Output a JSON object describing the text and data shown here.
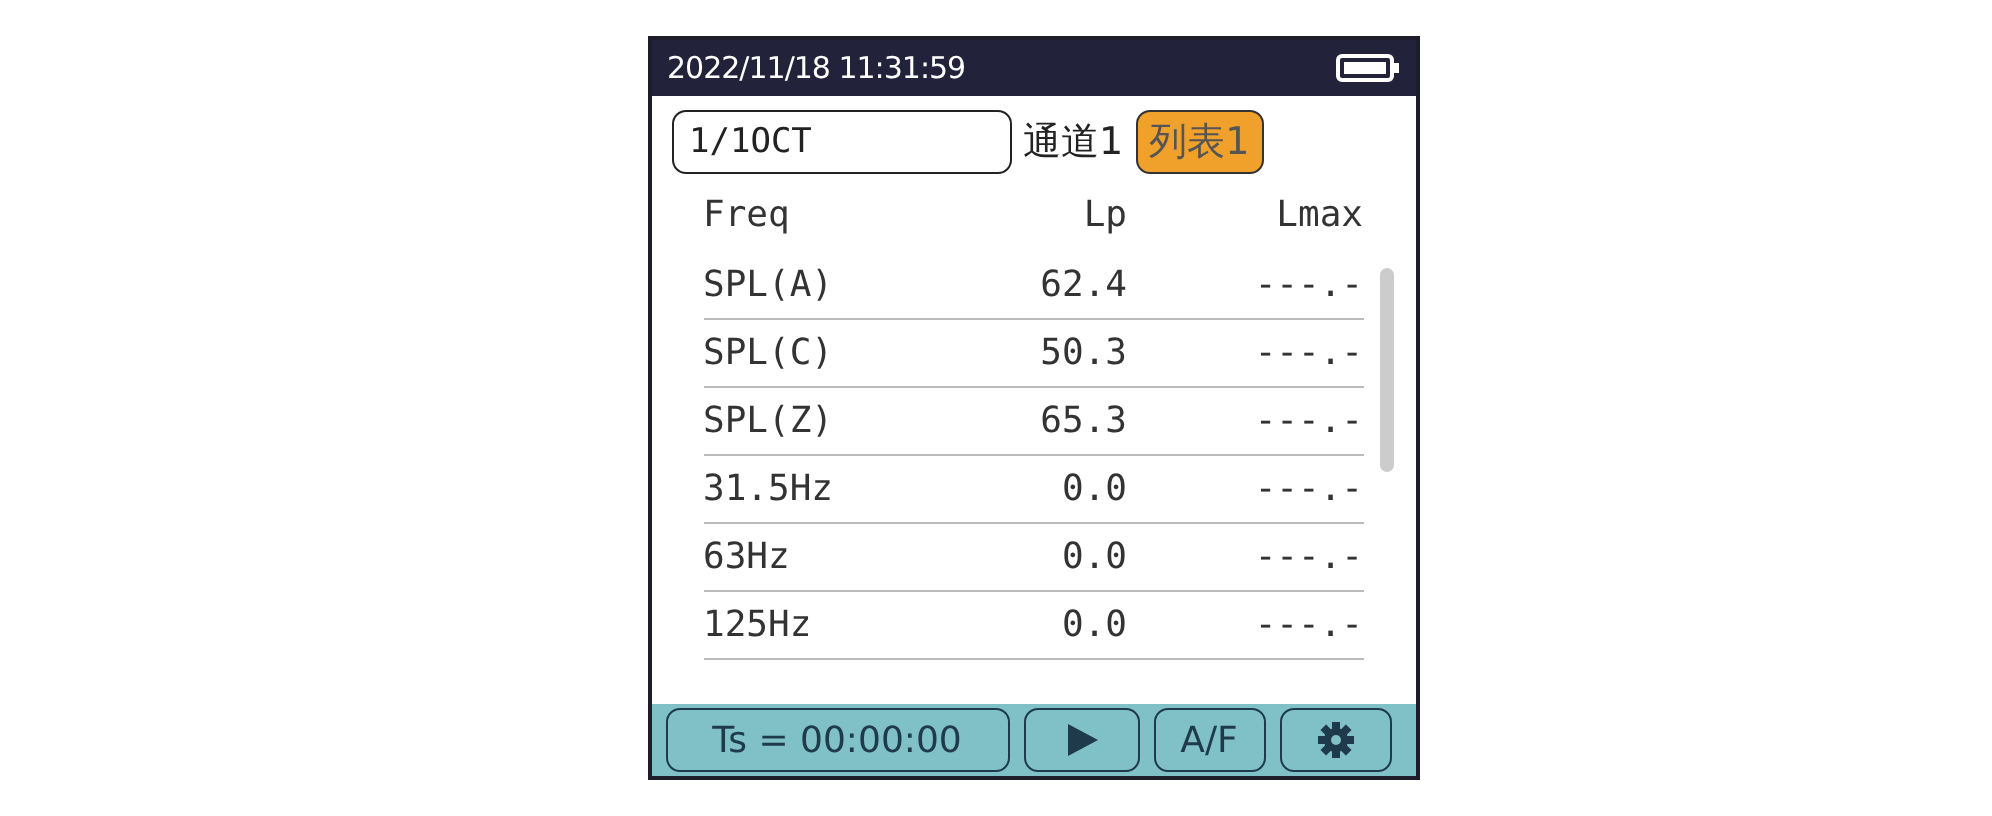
{
  "status_bar": {
    "datetime": "2022/11/18 11:31:59"
  },
  "mode_field": {
    "value": "1/1OCT"
  },
  "channel_label": "通道1",
  "list_button": {
    "label": "列表1",
    "selected": true
  },
  "table": {
    "columns": [
      "Freq",
      "Lp",
      "Lmax"
    ],
    "rows": [
      [
        "SPL(A)",
        "62.4",
        "---.-"
      ],
      [
        "SPL(C)",
        "50.3",
        "---.-"
      ],
      [
        "SPL(Z)",
        "65.3",
        "---.-"
      ],
      [
        "31.5Hz",
        "0.0",
        "---.-"
      ],
      [
        "63Hz",
        "0.0",
        "---.-"
      ],
      [
        "125Hz",
        "0.0",
        "---.-"
      ]
    ]
  },
  "toolbar": {
    "timer": "Ts = 00:00:00",
    "af_label": "A/F"
  }
}
